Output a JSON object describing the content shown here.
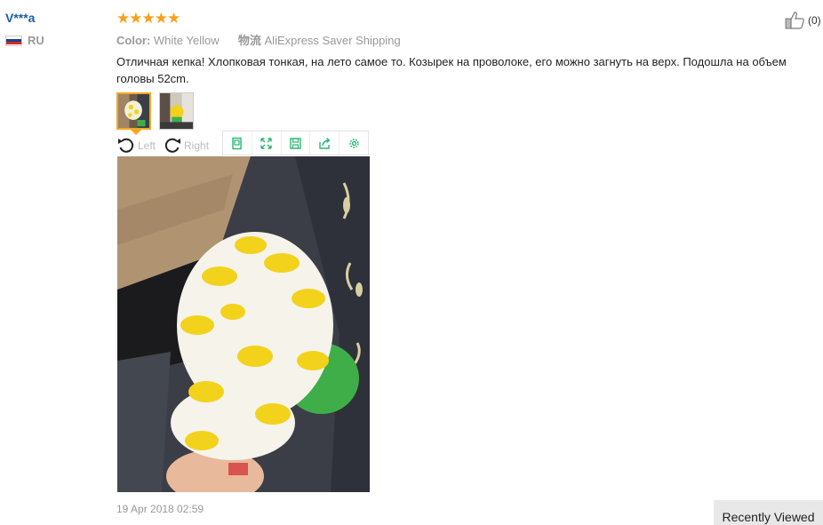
{
  "reviewer": {
    "name": "V***a",
    "country_code": "RU",
    "flag_colors": [
      "#ffffff",
      "#1c3f94",
      "#d52b1e"
    ]
  },
  "review": {
    "rating": 5,
    "stars": "★★★★★",
    "color_label": "Color:",
    "color_value": "White Yellow",
    "shipping_label": "物流",
    "shipping_value": "AliExpress Saver Shipping",
    "text": "Отличная кепка! Хлопковая тонкая, на лето самое то. Козырек на проволоке, его можно загнуть на верх. Подошла на объем головы 52cm.",
    "date": "19 Apr 2018 02:59",
    "helpful_count": "(0)"
  },
  "viewer": {
    "rotate_left_label": "Left",
    "rotate_right_label": "Right",
    "tools": [
      "original-size-icon",
      "fullscreen-icon",
      "save-icon",
      "share-icon",
      "settings-icon"
    ],
    "accent_color": "#2bb673"
  },
  "footer": {
    "recently_viewed": "Recently Viewed"
  }
}
